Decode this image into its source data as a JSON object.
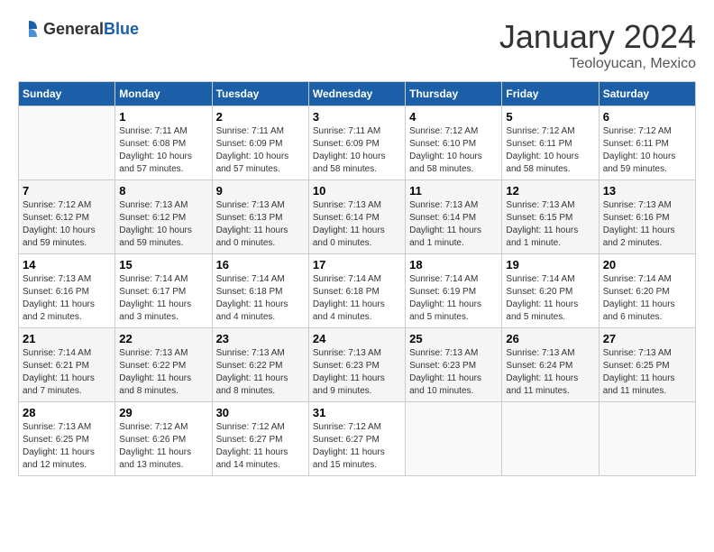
{
  "header": {
    "logo_general": "General",
    "logo_blue": "Blue",
    "month": "January 2024",
    "location": "Teoloyucan, Mexico"
  },
  "days_of_week": [
    "Sunday",
    "Monday",
    "Tuesday",
    "Wednesday",
    "Thursday",
    "Friday",
    "Saturday"
  ],
  "weeks": [
    [
      {
        "day": "",
        "info": ""
      },
      {
        "day": "1",
        "info": "Sunrise: 7:11 AM\nSunset: 6:08 PM\nDaylight: 10 hours\nand 57 minutes."
      },
      {
        "day": "2",
        "info": "Sunrise: 7:11 AM\nSunset: 6:09 PM\nDaylight: 10 hours\nand 57 minutes."
      },
      {
        "day": "3",
        "info": "Sunrise: 7:11 AM\nSunset: 6:09 PM\nDaylight: 10 hours\nand 58 minutes."
      },
      {
        "day": "4",
        "info": "Sunrise: 7:12 AM\nSunset: 6:10 PM\nDaylight: 10 hours\nand 58 minutes."
      },
      {
        "day": "5",
        "info": "Sunrise: 7:12 AM\nSunset: 6:11 PM\nDaylight: 10 hours\nand 58 minutes."
      },
      {
        "day": "6",
        "info": "Sunrise: 7:12 AM\nSunset: 6:11 PM\nDaylight: 10 hours\nand 59 minutes."
      }
    ],
    [
      {
        "day": "7",
        "info": "Sunrise: 7:12 AM\nSunset: 6:12 PM\nDaylight: 10 hours\nand 59 minutes."
      },
      {
        "day": "8",
        "info": "Sunrise: 7:13 AM\nSunset: 6:12 PM\nDaylight: 10 hours\nand 59 minutes."
      },
      {
        "day": "9",
        "info": "Sunrise: 7:13 AM\nSunset: 6:13 PM\nDaylight: 11 hours\nand 0 minutes."
      },
      {
        "day": "10",
        "info": "Sunrise: 7:13 AM\nSunset: 6:14 PM\nDaylight: 11 hours\nand 0 minutes."
      },
      {
        "day": "11",
        "info": "Sunrise: 7:13 AM\nSunset: 6:14 PM\nDaylight: 11 hours\nand 1 minute."
      },
      {
        "day": "12",
        "info": "Sunrise: 7:13 AM\nSunset: 6:15 PM\nDaylight: 11 hours\nand 1 minute."
      },
      {
        "day": "13",
        "info": "Sunrise: 7:13 AM\nSunset: 6:16 PM\nDaylight: 11 hours\nand 2 minutes."
      }
    ],
    [
      {
        "day": "14",
        "info": "Sunrise: 7:13 AM\nSunset: 6:16 PM\nDaylight: 11 hours\nand 2 minutes."
      },
      {
        "day": "15",
        "info": "Sunrise: 7:14 AM\nSunset: 6:17 PM\nDaylight: 11 hours\nand 3 minutes."
      },
      {
        "day": "16",
        "info": "Sunrise: 7:14 AM\nSunset: 6:18 PM\nDaylight: 11 hours\nand 4 minutes."
      },
      {
        "day": "17",
        "info": "Sunrise: 7:14 AM\nSunset: 6:18 PM\nDaylight: 11 hours\nand 4 minutes."
      },
      {
        "day": "18",
        "info": "Sunrise: 7:14 AM\nSunset: 6:19 PM\nDaylight: 11 hours\nand 5 minutes."
      },
      {
        "day": "19",
        "info": "Sunrise: 7:14 AM\nSunset: 6:20 PM\nDaylight: 11 hours\nand 5 minutes."
      },
      {
        "day": "20",
        "info": "Sunrise: 7:14 AM\nSunset: 6:20 PM\nDaylight: 11 hours\nand 6 minutes."
      }
    ],
    [
      {
        "day": "21",
        "info": "Sunrise: 7:14 AM\nSunset: 6:21 PM\nDaylight: 11 hours\nand 7 minutes."
      },
      {
        "day": "22",
        "info": "Sunrise: 7:13 AM\nSunset: 6:22 PM\nDaylight: 11 hours\nand 8 minutes."
      },
      {
        "day": "23",
        "info": "Sunrise: 7:13 AM\nSunset: 6:22 PM\nDaylight: 11 hours\nand 8 minutes."
      },
      {
        "day": "24",
        "info": "Sunrise: 7:13 AM\nSunset: 6:23 PM\nDaylight: 11 hours\nand 9 minutes."
      },
      {
        "day": "25",
        "info": "Sunrise: 7:13 AM\nSunset: 6:23 PM\nDaylight: 11 hours\nand 10 minutes."
      },
      {
        "day": "26",
        "info": "Sunrise: 7:13 AM\nSunset: 6:24 PM\nDaylight: 11 hours\nand 11 minutes."
      },
      {
        "day": "27",
        "info": "Sunrise: 7:13 AM\nSunset: 6:25 PM\nDaylight: 11 hours\nand 11 minutes."
      }
    ],
    [
      {
        "day": "28",
        "info": "Sunrise: 7:13 AM\nSunset: 6:25 PM\nDaylight: 11 hours\nand 12 minutes."
      },
      {
        "day": "29",
        "info": "Sunrise: 7:12 AM\nSunset: 6:26 PM\nDaylight: 11 hours\nand 13 minutes."
      },
      {
        "day": "30",
        "info": "Sunrise: 7:12 AM\nSunset: 6:27 PM\nDaylight: 11 hours\nand 14 minutes."
      },
      {
        "day": "31",
        "info": "Sunrise: 7:12 AM\nSunset: 6:27 PM\nDaylight: 11 hours\nand 15 minutes."
      },
      {
        "day": "",
        "info": ""
      },
      {
        "day": "",
        "info": ""
      },
      {
        "day": "",
        "info": ""
      }
    ]
  ]
}
